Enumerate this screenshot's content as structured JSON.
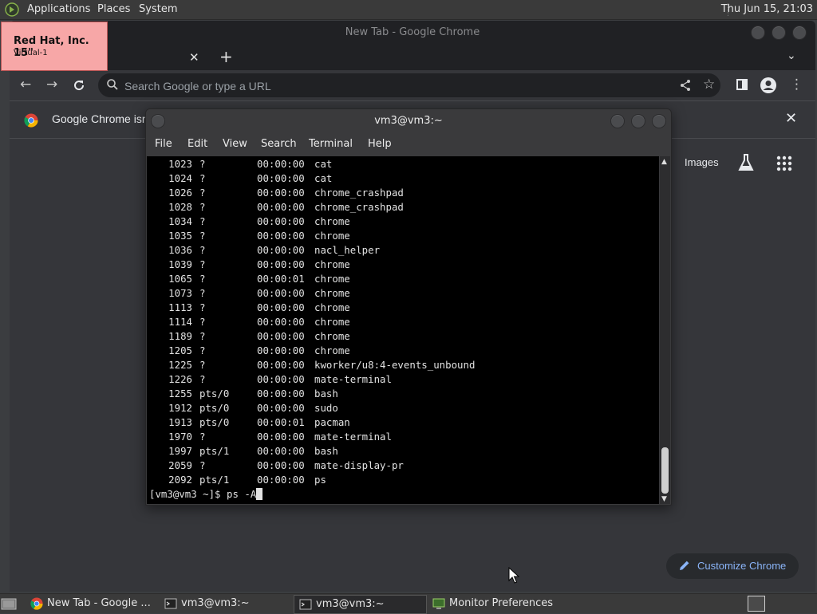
{
  "top_panel": {
    "menus": [
      "Applications",
      "Places",
      "System"
    ],
    "clock": "Thu Jun 15, 21:03"
  },
  "monitor_label": {
    "name": "Red Hat, Inc. 15\"",
    "sub": "Virtual-1"
  },
  "chrome": {
    "window_title": "New Tab - Google Chrome",
    "omnibox_placeholder": "Search Google or type a URL",
    "infobar_text": "Google Chrome isn",
    "ntp_images": "Images",
    "customize_label": "Customize Chrome",
    "accent_color": "#8ab4f8"
  },
  "terminal": {
    "title": "vm3@vm3:~",
    "menu": [
      "File",
      "Edit",
      "View",
      "Search",
      "Terminal",
      "Help"
    ],
    "processes": [
      {
        "pid": "1023",
        "tty": "?",
        "time": "00:00:00",
        "cmd": "cat"
      },
      {
        "pid": "1024",
        "tty": "?",
        "time": "00:00:00",
        "cmd": "cat"
      },
      {
        "pid": "1026",
        "tty": "?",
        "time": "00:00:00",
        "cmd": "chrome_crashpad"
      },
      {
        "pid": "1028",
        "tty": "?",
        "time": "00:00:00",
        "cmd": "chrome_crashpad"
      },
      {
        "pid": "1034",
        "tty": "?",
        "time": "00:00:00",
        "cmd": "chrome"
      },
      {
        "pid": "1035",
        "tty": "?",
        "time": "00:00:00",
        "cmd": "chrome"
      },
      {
        "pid": "1036",
        "tty": "?",
        "time": "00:00:00",
        "cmd": "nacl_helper"
      },
      {
        "pid": "1039",
        "tty": "?",
        "time": "00:00:00",
        "cmd": "chrome"
      },
      {
        "pid": "1065",
        "tty": "?",
        "time": "00:00:01",
        "cmd": "chrome"
      },
      {
        "pid": "1073",
        "tty": "?",
        "time": "00:00:00",
        "cmd": "chrome"
      },
      {
        "pid": "1113",
        "tty": "?",
        "time": "00:00:00",
        "cmd": "chrome"
      },
      {
        "pid": "1114",
        "tty": "?",
        "time": "00:00:00",
        "cmd": "chrome"
      },
      {
        "pid": "1189",
        "tty": "?",
        "time": "00:00:00",
        "cmd": "chrome"
      },
      {
        "pid": "1205",
        "tty": "?",
        "time": "00:00:00",
        "cmd": "chrome"
      },
      {
        "pid": "1225",
        "tty": "?",
        "time": "00:00:00",
        "cmd": "kworker/u8:4-events_unbound"
      },
      {
        "pid": "1226",
        "tty": "?",
        "time": "00:00:00",
        "cmd": "mate-terminal"
      },
      {
        "pid": "1255",
        "tty": "pts/0",
        "time": "00:00:00",
        "cmd": "bash"
      },
      {
        "pid": "1912",
        "tty": "pts/0",
        "time": "00:00:00",
        "cmd": "sudo"
      },
      {
        "pid": "1913",
        "tty": "pts/0",
        "time": "00:00:01",
        "cmd": "pacman"
      },
      {
        "pid": "1970",
        "tty": "?",
        "time": "00:00:00",
        "cmd": "mate-terminal"
      },
      {
        "pid": "1997",
        "tty": "pts/1",
        "time": "00:00:00",
        "cmd": "bash"
      },
      {
        "pid": "2059",
        "tty": "?",
        "time": "00:00:00",
        "cmd": "mate-display-pr"
      },
      {
        "pid": "2092",
        "tty": "pts/1",
        "time": "00:00:00",
        "cmd": "ps"
      }
    ],
    "prompt": "[vm3@vm3 ~]$ ",
    "command": "ps -A"
  },
  "taskbar": {
    "items": [
      {
        "label": "New Tab - Google ...",
        "icon": "chrome-icon"
      },
      {
        "label": "vm3@vm3:~",
        "icon": "terminal-icon"
      },
      {
        "label": "vm3@vm3:~",
        "icon": "terminal-icon"
      },
      {
        "label": "Monitor Preferences",
        "icon": "monitor-icon"
      }
    ]
  }
}
